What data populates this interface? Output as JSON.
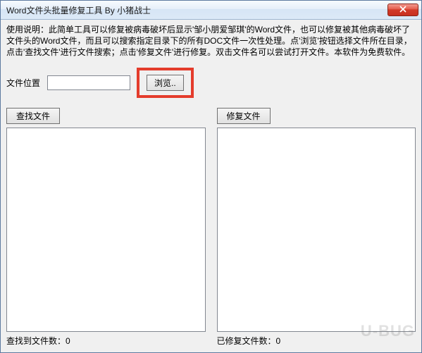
{
  "window": {
    "title": "Word文件头批量修复工具  By 小猪战士"
  },
  "instructions": "使用说明：此简单工具可以修复被病毒破坏后显示'邹小朋爱邹琪'的Word文件，也可以修复被其他病毒破坏了文件头的Word文件，而且可以搜索指定目录下的所有DOC文件一次性处理。点'浏览'按钮选择文件所在目录，点击'查找文件'进行文件搜索；点击'修复文件'进行修复。双击文件名可以尝试打开文件。本软件为免费软件。",
  "filepath": {
    "label": "文件位置",
    "value": ""
  },
  "buttons": {
    "browse": "浏览..",
    "search": "查找文件",
    "repair": "修复文件"
  },
  "counts": {
    "found_label": "查找到文件数：",
    "found_value": "0",
    "repaired_label": "已修复文件数：",
    "repaired_value": "0"
  },
  "watermark": "U-BUG"
}
